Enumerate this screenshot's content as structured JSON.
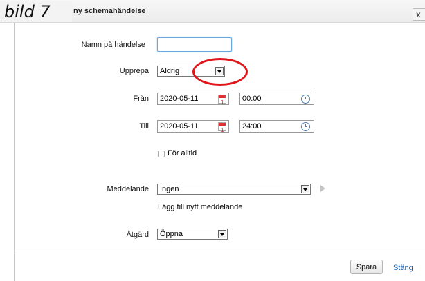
{
  "overlay": {
    "caption": "bild 7"
  },
  "dialog": {
    "title": "ny schemahändelse",
    "close_label": "x"
  },
  "form": {
    "name": {
      "label": "Namn på händelse",
      "value": ""
    },
    "repeat": {
      "label": "Upprepa",
      "value": "Aldrig"
    },
    "from": {
      "label": "Från",
      "date": "2020-05-11",
      "time": "00:00"
    },
    "to": {
      "label": "Till",
      "date": "2020-05-11",
      "time": "24:00"
    },
    "forever": {
      "label": "För alltid",
      "checked": false
    },
    "message": {
      "label": "Meddelande",
      "value": "Ingen",
      "add_link": "Lägg till nytt meddelande"
    },
    "action": {
      "label": "Åtgärd",
      "value": "Öppna"
    }
  },
  "calendar_icon_number": "1",
  "footer": {
    "save_label": "Spara",
    "close_label": "Stäng"
  },
  "colors": {
    "highlight": "#e0161b",
    "link": "#1a5fb4",
    "focus": "#6aa6df"
  }
}
